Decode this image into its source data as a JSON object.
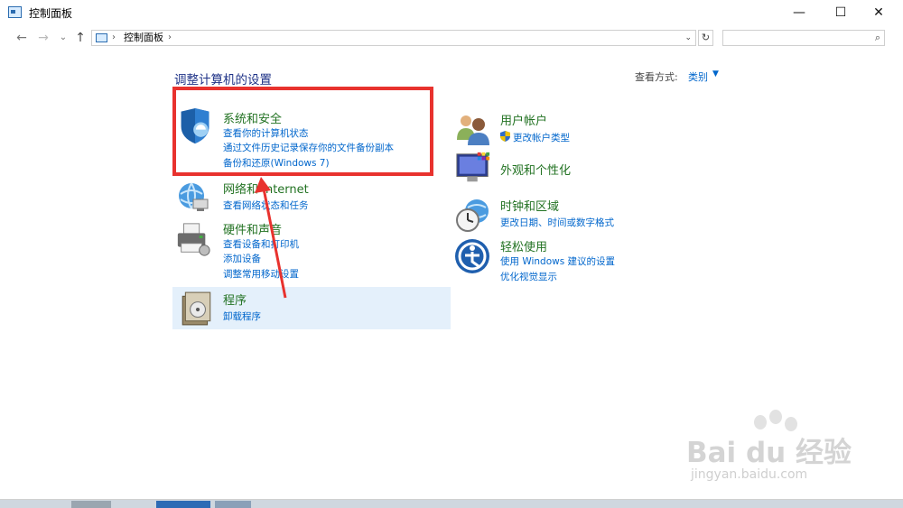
{
  "window": {
    "title": "控制面板",
    "minimize": "—",
    "maximize": "☐",
    "close": "✕"
  },
  "nav": {
    "back": "←",
    "forward": "→",
    "recent": "⌄",
    "up": "↑",
    "breadcrumb_sep": "›",
    "breadcrumb": "控制面板",
    "dropdown": "⌄",
    "refresh": "↻",
    "search_placeholder": "",
    "search_icon": "⌕"
  },
  "main": {
    "heading": "调整计算机的设置",
    "view_by_label": "查看方式:",
    "view_by_value": "类别",
    "view_caret": "▼"
  },
  "categories": [
    {
      "id": "system-security",
      "title": "系统和安全",
      "icon": "shield-icon",
      "links": [
        "查看你的计算机状态",
        "通过文件历史记录保存你的文件备份副本",
        "备份和还原(Windows 7)"
      ]
    },
    {
      "id": "network-internet",
      "title": "网络和 Internet",
      "icon": "network-globe-icon",
      "links": [
        "查看网络状态和任务"
      ]
    },
    {
      "id": "hardware-sound",
      "title": "硬件和声音",
      "icon": "printer-icon",
      "links": [
        "查看设备和打印机",
        "添加设备",
        "调整常用移动设置"
      ]
    },
    {
      "id": "programs",
      "title": "程序",
      "icon": "programs-disk-icon",
      "links": [
        "卸载程序"
      ]
    },
    {
      "id": "user-accounts",
      "title": "用户帐户",
      "icon": "users-icon",
      "links": [
        "更改帐户类型"
      ]
    },
    {
      "id": "appearance",
      "title": "外观和个性化",
      "icon": "monitor-palette-icon",
      "links": []
    },
    {
      "id": "clock-region",
      "title": "时钟和区域",
      "icon": "clock-globe-icon",
      "links": [
        "更改日期、时间或数字格式"
      ]
    },
    {
      "id": "ease-access",
      "title": "轻松使用",
      "icon": "accessibility-icon",
      "links": [
        "使用 Windows 建议的设置",
        "优化视觉显示"
      ]
    }
  ],
  "watermark": {
    "brand": "Bai du 经验",
    "url": "jingyan.baidu.com"
  },
  "colors": {
    "category_title": "#227222",
    "link": "#0066cc",
    "heading": "#1e3287",
    "highlight_box": "#e8322e",
    "selected_bg": "#e4f0fb"
  }
}
